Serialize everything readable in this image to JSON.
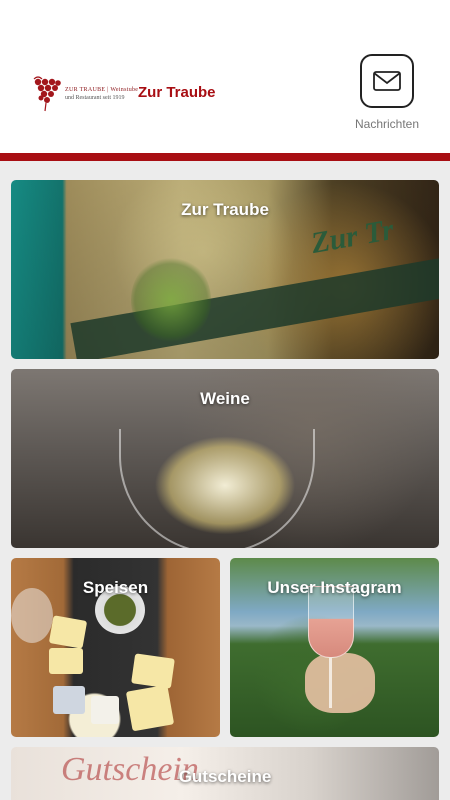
{
  "header": {
    "logo_line1": "ZUR TRAUBE | Weinstube",
    "logo_line2": "und Restaurant seit 1919",
    "brand_name": "Zur Traube",
    "messages_label": "Nachrichten",
    "accent_color": "#a80e13"
  },
  "tiles": [
    {
      "title": "Zur Traube"
    },
    {
      "title": "Weine"
    },
    {
      "title": "Speisen"
    },
    {
      "title": "Unser Instagram"
    },
    {
      "title": "Gutscheine"
    }
  ],
  "icons": {
    "messages": "envelope-icon",
    "logo": "grape-icon"
  }
}
